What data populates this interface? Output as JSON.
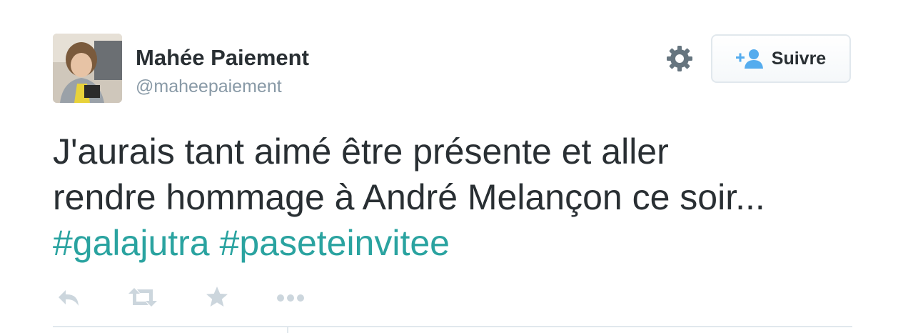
{
  "user": {
    "name": "Mahée Paiement",
    "handle": "@maheepaiement",
    "avatar_icon": "profile-photo"
  },
  "header": {
    "settings_icon": "gear-icon",
    "follow_label": "Suivre",
    "follow_icon": "add-user-icon"
  },
  "tweet": {
    "line1": "J'aurais tant aimé être présente et aller",
    "line2": "rendre hommage à André Melançon ce soir...",
    "hashtags": [
      "#galajutra",
      "#paseteinvitee"
    ]
  },
  "actions": [
    {
      "icon": "reply-icon"
    },
    {
      "icon": "retweet-icon"
    },
    {
      "icon": "favorite-star-icon"
    },
    {
      "icon": "more-dots-icon"
    }
  ],
  "colors": {
    "text": "#292f33",
    "muted": "#8899a6",
    "hashtag": "#2aa3a0",
    "accent": "#55acee",
    "icon": "#ccd6dd",
    "border": "#e1e8ed"
  }
}
